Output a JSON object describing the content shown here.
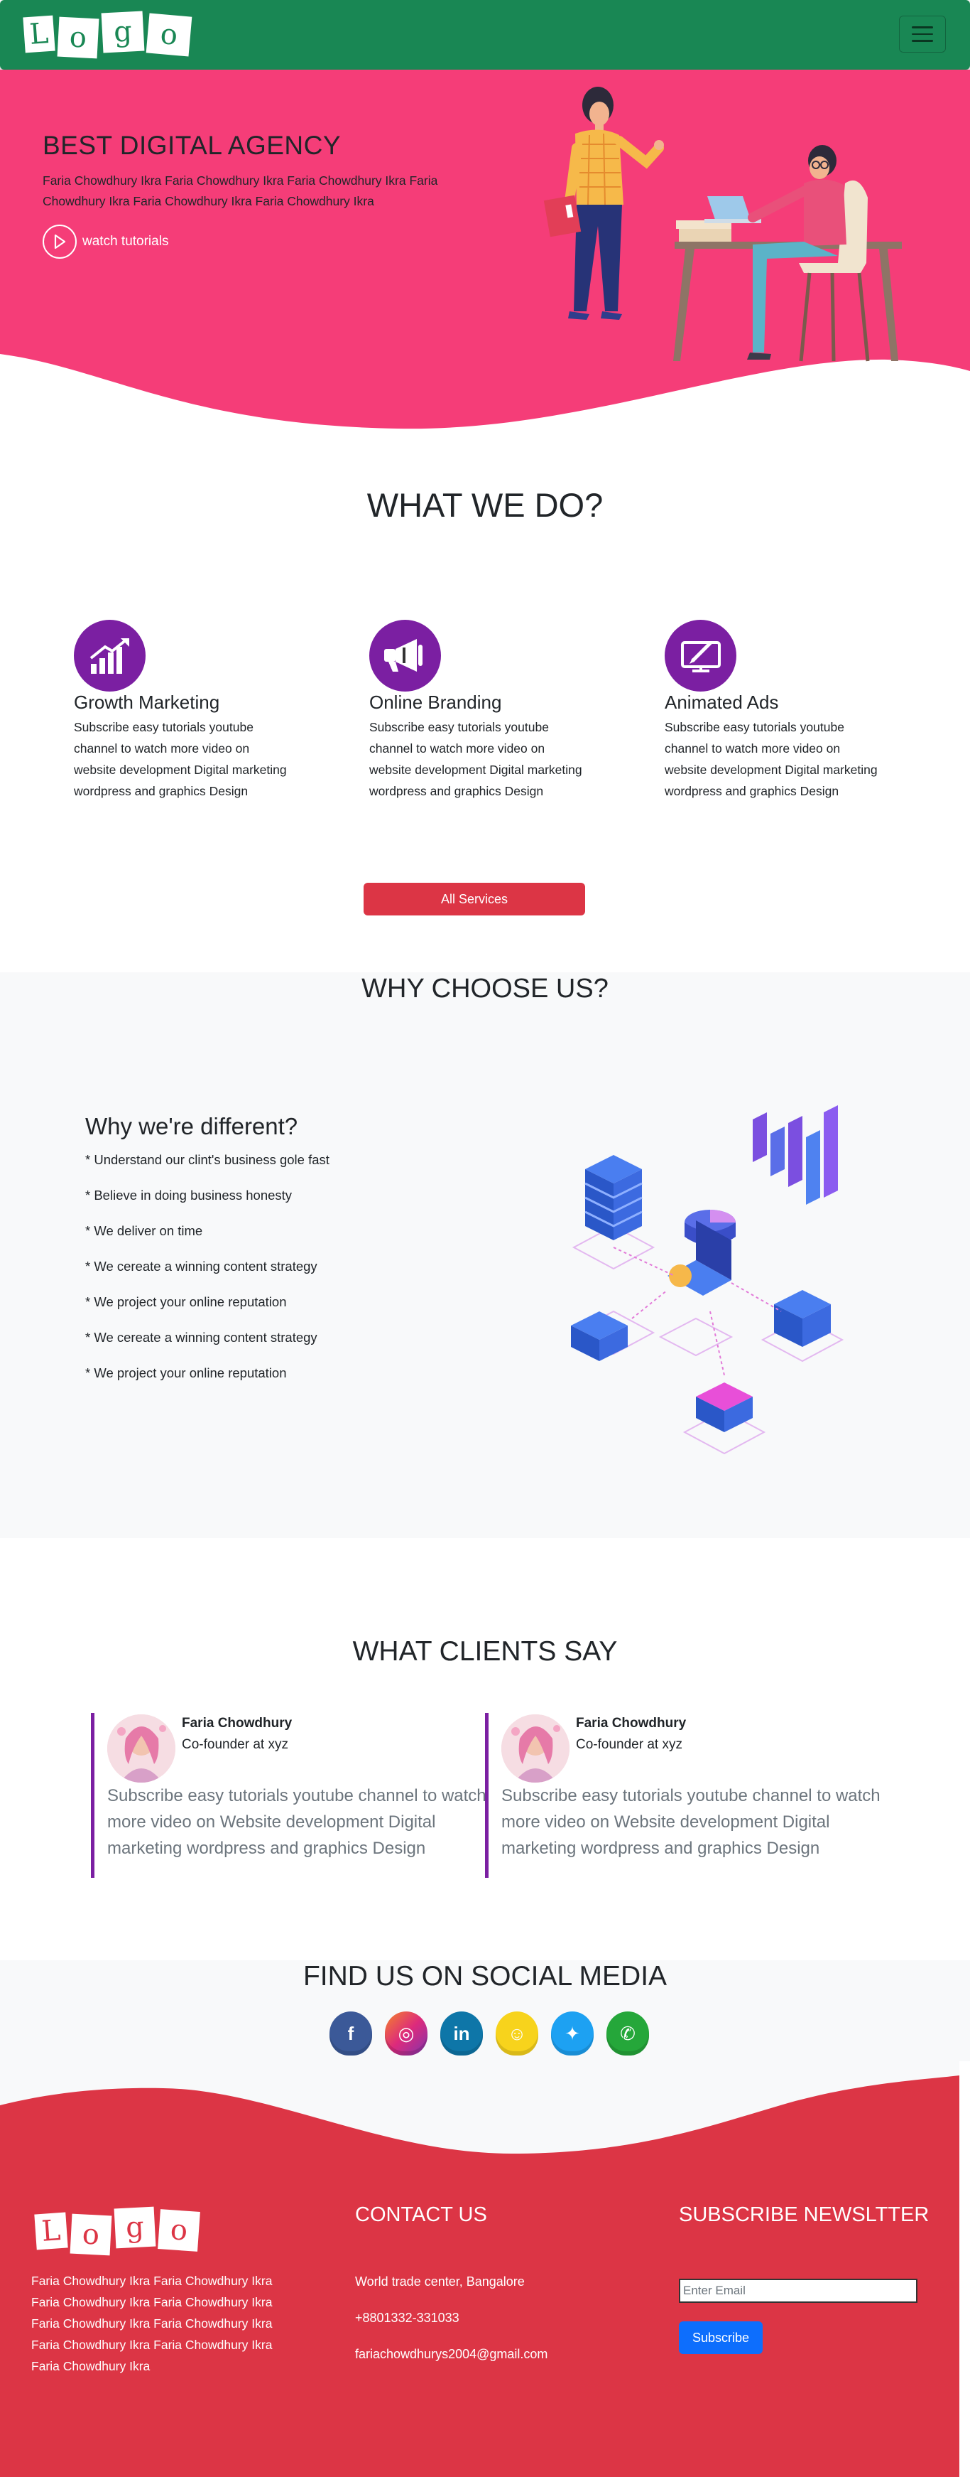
{
  "navbar": {
    "logo_letters": [
      "L",
      "o",
      "g",
      "o"
    ],
    "toggler_icon": "hamburger-icon",
    "bg_color": "#198754"
  },
  "hero": {
    "title": "BEST DIGITAL AGENCY",
    "description": "Faria Chowdhury Ikra Faria Chowdhury Ikra Faria Chowdhury Ikra Faria Chowdhury Ikra Faria Chowdhury Ikra Faria Chowdhury Ikra",
    "watch_label": "watch tutorials",
    "bg_color": "#f53d78"
  },
  "what_we_do": {
    "title": "WHAT WE DO?",
    "services": [
      {
        "icon": "growth-chart-icon",
        "title": "Growth Marketing",
        "text": "Subscribe easy tutorials youtube channel to watch more video on website development Digital marketing wordpress and graphics Design"
      },
      {
        "icon": "megaphone-icon",
        "title": "Online Branding",
        "text": "Subscribe easy tutorials youtube channel to watch more video on website development Digital marketing wordpress and graphics Design"
      },
      {
        "icon": "monitor-edit-icon",
        "title": "Animated Ads",
        "text": "Subscribe easy tutorials youtube channel to watch more video on website development Digital marketing wordpress and graphics Design"
      }
    ],
    "button_label": "All Services"
  },
  "why_choose": {
    "title": "WHY CHOOSE US?",
    "subtitle": "Why we're different?",
    "points": [
      "* Understand our clint's business gole fast",
      "* Believe in doing business honesty",
      "* We deliver on time",
      "* We cereate a winning content strategy",
      "* We project your online reputation",
      "* We cereate a winning content strategy",
      "* We project your online reputation"
    ]
  },
  "clients": {
    "title": "WHAT CLIENTS SAY",
    "testimonials": [
      {
        "name": "Faria Chowdhury",
        "role": "Co-founder at xyz",
        "quote": "Subscribe easy tutorials youtube channel to watch more video on Website development Digital marketing wordpress and graphics Design"
      },
      {
        "name": "Faria Chowdhury",
        "role": "Co-founder at xyz",
        "quote": "Subscribe easy tutorials youtube channel to watch more video on Website development Digital marketing wordpress and graphics Design"
      }
    ]
  },
  "social": {
    "title": "FIND US ON SOCIAL MEDIA",
    "icons": [
      {
        "name": "facebook-icon",
        "glyph": "f",
        "color": "#3b5998"
      },
      {
        "name": "instagram-icon",
        "glyph": "◎",
        "color": "#c13584"
      },
      {
        "name": "linkedin-icon",
        "glyph": "in",
        "color": "#0e76a8"
      },
      {
        "name": "snapchat-icon",
        "glyph": "☺",
        "color": "#f7d31c"
      },
      {
        "name": "twitter-icon",
        "glyph": "✦",
        "color": "#1da1f2"
      },
      {
        "name": "whatsapp-icon",
        "glyph": "✆",
        "color": "#25a73a"
      }
    ]
  },
  "footer": {
    "logo_letters": [
      "L",
      "o",
      "g",
      "o"
    ],
    "about": "Faria Chowdhury Ikra Faria Chowdhury Ikra Faria Chowdhury Ikra Faria Chowdhury Ikra Faria Chowdhury Ikra Faria Chowdhury Ikra Faria Chowdhury Ikra Faria Chowdhury Ikra Faria Chowdhury Ikra",
    "contact_title": "CONTACT US",
    "address": "World trade center, Bangalore",
    "phone": "+8801332-331033",
    "email": "fariachowdhurys2004@gmail.com",
    "subscribe_title": "SUBSCRIBE NEWSLTTER",
    "email_placeholder": "Enter Email",
    "subscribe_label": "Subscribe",
    "bg_color": "#dc3545"
  }
}
